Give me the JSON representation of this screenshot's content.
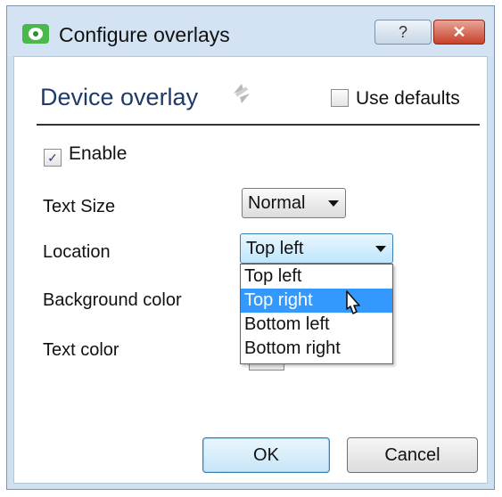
{
  "window": {
    "title": "Configure overlays"
  },
  "titlebar": {
    "help_label": "?",
    "close_label": "✕"
  },
  "section": {
    "title": "Device overlay"
  },
  "use_defaults": {
    "label": "Use defaults",
    "checked": false
  },
  "enable": {
    "label": "Enable",
    "checked": true,
    "check_mark": "✓"
  },
  "fields": {
    "text_size": {
      "label": "Text Size",
      "value": "Normal"
    },
    "location": {
      "label": "Location",
      "value": "Top left"
    },
    "background_color": {
      "label": "Background color"
    },
    "text_color": {
      "label": "Text color"
    }
  },
  "location_dropdown": {
    "options": [
      "Top left",
      "Top right",
      "Bottom left",
      "Bottom right"
    ],
    "highlighted": "Top right"
  },
  "buttons": {
    "ok": "OK",
    "cancel": "Cancel"
  },
  "icons": [
    "app-icon",
    "help-icon",
    "close-icon",
    "refresh-icon",
    "checkbox-icon",
    "chevron-down-icon",
    "cursor-icon"
  ],
  "colors": {
    "highlight": "#3399ff",
    "title_accent": "#1f3a68",
    "close_red": "#c7402c"
  }
}
